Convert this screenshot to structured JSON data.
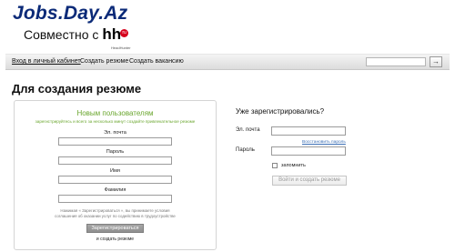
{
  "header": {
    "logo_text": "Jobs.Day.Az",
    "partner_prefix": "Совместно с",
    "partner_logo": "hh",
    "partner_badge": "ru",
    "partner_caption": "HeadHunter"
  },
  "nav": {
    "items": [
      {
        "label": "Вход в личный кабинет",
        "active": true
      },
      {
        "label": "Создать резюме",
        "active": false
      },
      {
        "label": "Создать вакансию",
        "active": false
      }
    ],
    "search_placeholder": "",
    "search_button": "→"
  },
  "page_title": "Для создания резюме",
  "register": {
    "title": "Новым пользователям",
    "description": "зарегистрируйтесь и всего за несколько минут создайте привлекательное резюме",
    "fields": {
      "email": "Эл. почта",
      "password": "Пароль",
      "first_name": "Имя",
      "last_name": "Фамилия"
    },
    "legal_line1": "Нажимая « Зарегистрироваться », вы принимаете условия",
    "legal_line2": "соглашения об оказании услуг по содействию в трудоустройстве",
    "button": "Зарегистрироваться",
    "link": "и создать резюме"
  },
  "login": {
    "title": "Уже зарегистрировались?",
    "email_label": "Эл. почта",
    "password_label": "Пароль",
    "restore_link": "Восстановить пароль",
    "remember_label": "запомнить",
    "button": "Войти и создать резюме"
  },
  "colors": {
    "logo": "#0b2a78",
    "accent_green": "#6aa62e",
    "link_blue": "#3b6fb6"
  }
}
